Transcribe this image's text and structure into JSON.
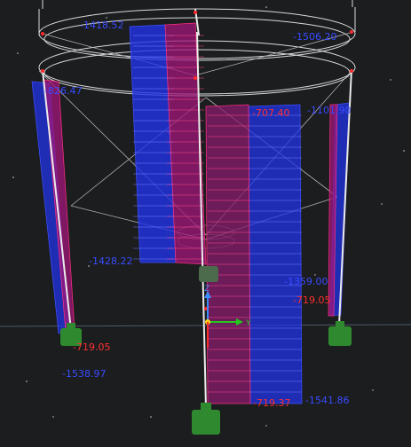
{
  "viewport": {
    "background": "#1b1d1f"
  },
  "colors": {
    "blue": "#2233e8",
    "magenta": "#c0157a",
    "red": "#ff2a2a",
    "white": "#e8e8e8",
    "support_green": "#2f8a2f",
    "axis_x": "#22c81f",
    "axis_y": "#ffd11a",
    "axis_z": "#3b8cff"
  },
  "labels": {
    "top_left": "-1418.52",
    "top_right": "-1506.20",
    "left_upper": "-826.47",
    "mid_red": "-707.40",
    "mid_blue": "-1101.90",
    "mid_left": "-1428.22",
    "mid_right_blue": "-1359.00",
    "mid_right_red": "-719.05",
    "bottom_left_red": "-719.05",
    "bottom_left_blue": "-1538.97",
    "bottom_red": "-719.37",
    "bottom_blue": "-1541.86"
  },
  "axes": {
    "x": "X",
    "y": "Y",
    "z": "Z"
  }
}
